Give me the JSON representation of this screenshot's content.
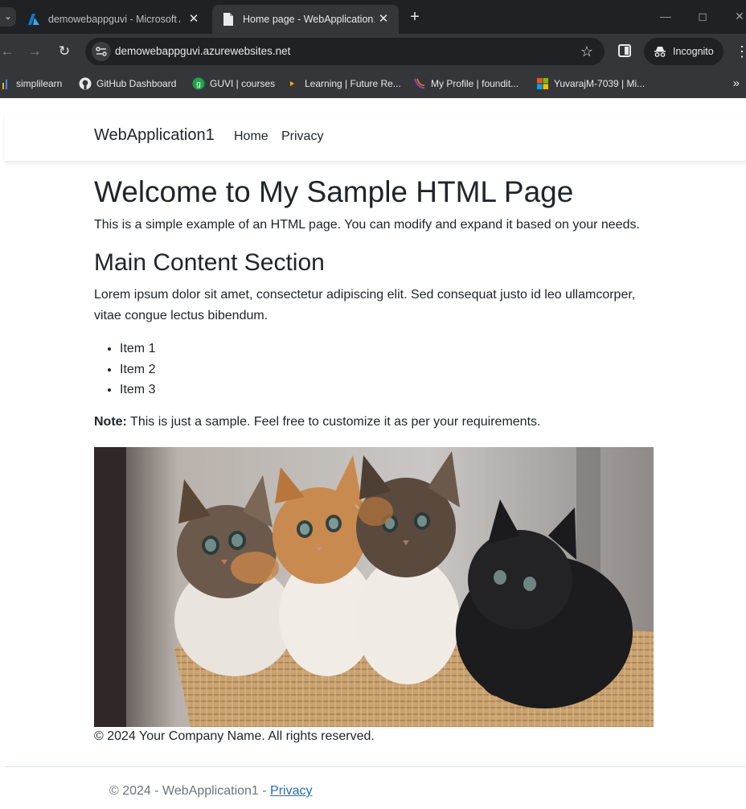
{
  "browser": {
    "tabs": [
      {
        "title": "demowebappguvi - Microsoft A",
        "icon": "azure-icon",
        "active": false
      },
      {
        "title": "Home page - WebApplication1",
        "icon": "document-icon",
        "active": true
      }
    ],
    "new_tab": "+",
    "address": "demowebappguvi.azurewebsites.net",
    "incognito_label": "Incognito",
    "bookmarks": [
      {
        "label": "simplilearn",
        "icon": "simplilearn-icon"
      },
      {
        "label": "GitHub Dashboard",
        "icon": "github-icon"
      },
      {
        "label": "GUVI | courses",
        "icon": "guvi-icon"
      },
      {
        "label": "Learning | Future Re...",
        "icon": "learning-icon"
      },
      {
        "label": "My Profile | foundit...",
        "icon": "foundit-icon"
      },
      {
        "label": "YuvarajM-7039 | Mi...",
        "icon": "microsoft-icon"
      }
    ],
    "bookmarks_more": "»"
  },
  "site": {
    "brand": "WebApplication1",
    "nav": [
      "Home",
      "Privacy"
    ]
  },
  "content": {
    "title": "Welcome to My Sample HTML Page",
    "intro": "This is a simple example of an HTML page. You can modify and expand it based on your needs.",
    "section_heading": "Main Content Section",
    "lorem": "Lorem ipsum dolor sit amet, consectetur adipiscing elit. Sed consequat justo id leo ullamcorper, vitae congue lectus bibendum.",
    "items": [
      "Item 1",
      "Item 2",
      "Item 3"
    ],
    "note_label": "Note:",
    "note_text": " This is just a sample. Feel free to customize it as per your requirements.",
    "copyright": "© 2024 Your Company Name. All rights reserved."
  },
  "footer": {
    "text": "© 2024 - WebApplication1 - ",
    "privacy_link": "Privacy"
  },
  "colors": {
    "tabbar": "#202124",
    "toolbar": "#35363a",
    "link": "#1b6ec2",
    "footer_text": "#6c757d"
  }
}
